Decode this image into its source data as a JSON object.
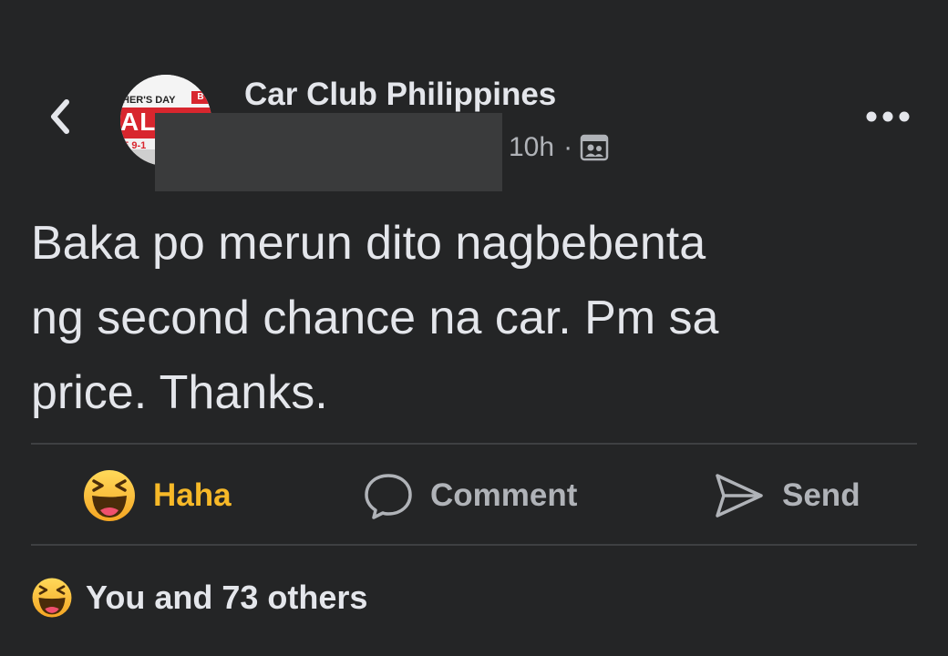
{
  "header": {
    "back_icon": "chevron-left-icon",
    "group_name": "Car Club Philippines",
    "time": "10h",
    "separator": "·",
    "privacy_icon": "group-members-icon",
    "more_icon": "more-horizontal-icon",
    "avatar_text": {
      "line1": "HER'S DAY",
      "line2": "AL",
      "line3": "E 9-1",
      "badge": "B"
    }
  },
  "post": {
    "lines": [
      "Baka po merun dito nagbebenta",
      "ng second chance na car. Pm sa",
      "price. Thanks."
    ]
  },
  "actions": {
    "haha_label": "Haha",
    "comment_label": "Comment",
    "send_label": "Send"
  },
  "reactions": {
    "summary": "You and 73 others"
  },
  "colors": {
    "background": "#242526",
    "text_primary": "#e4e6eb",
    "text_secondary": "#b0b3b8",
    "haha_accent": "#f7b928",
    "divider": "#3e4042",
    "redaction": "#3a3b3c"
  }
}
